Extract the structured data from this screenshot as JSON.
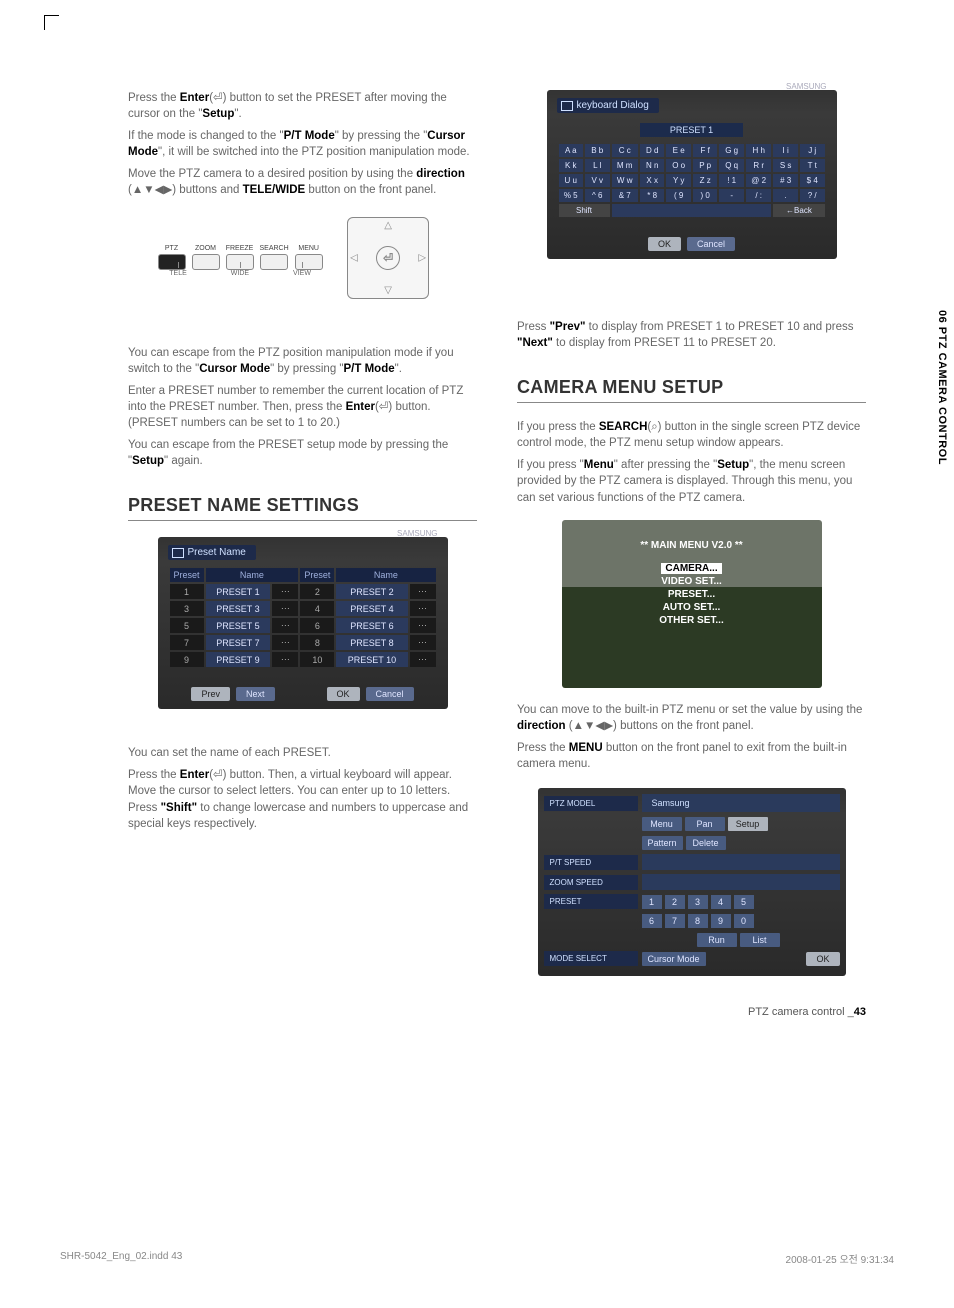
{
  "side_tab": "06 PTZ CAMERA CONTROL",
  "left": {
    "p1a": "Press the ",
    "p1b": "Enter",
    "p1c": "(⏎) button to set the PRESET after moving the cursor on the \"",
    "p1d": "Setup",
    "p1e": "\".",
    "p2a": "If the mode is changed to the \"",
    "p2b": "P/T Mode",
    "p2c": "\" by pressing the \"",
    "p2d": "Cursor Mode",
    "p2e": "\", it will be switched into the PTZ position manipulation mode.",
    "p3a": "Move the PTZ camera to a desired position by using the ",
    "p3b": "direction",
    "p3c": " (▲▼◀▶) buttons and ",
    "p3d": "TELE/WIDE",
    "p3e": " button on the front panel.",
    "dvr": {
      "b1": "PTZ",
      "b2": "ZOOM",
      "b3": "FREEZE",
      "b4": "SEARCH",
      "b5": "MENU",
      "tele": "TELE",
      "wide": "WIDE",
      "view": "VIEW"
    },
    "p4a": "You can escape from the PTZ position manipulation mode if you switch to the \"",
    "p4b": "Cursor Mode",
    "p4c": "\" by pressing \"",
    "p4d": "P/T Mode",
    "p4e": "\".",
    "p5": "Enter a PRESET number to remember the current location of PTZ into the PRESET number. Then, press the ",
    "p5b": "Enter",
    "p5c": "(⏎) button. (PRESET numbers can be set to 1 to 20.)",
    "p6a": "You can escape from the PRESET setup mode by pressing the \"",
    "p6b": "Setup",
    "p6c": "\" again.",
    "h_preset_name": "PRESET NAME SETTINGS",
    "table": {
      "title": "Preset Name",
      "brand": "SAMSUNG",
      "hdr_preset": "Preset",
      "hdr_name": "Name",
      "rows": [
        {
          "n1": "1",
          "v1": "PRESET 1",
          "n2": "2",
          "v2": "PRESET 2"
        },
        {
          "n1": "3",
          "v1": "PRESET 3",
          "n2": "4",
          "v2": "PRESET 4"
        },
        {
          "n1": "5",
          "v1": "PRESET 5",
          "n2": "6",
          "v2": "PRESET 6"
        },
        {
          "n1": "7",
          "v1": "PRESET 7",
          "n2": "8",
          "v2": "PRESET 8"
        },
        {
          "n1": "9",
          "v1": "PRESET 9",
          "n2": "10",
          "v2": "PRESET 10"
        }
      ],
      "prev": "Prev",
      "next": "Next",
      "ok": "OK",
      "cancel": "Cancel"
    },
    "p7": "You can set the name of each PRESET.",
    "p8a": "Press the ",
    "p8b": "Enter",
    "p8c": "(⏎) button. Then, a virtual keyboard will appear. Move the cursor to select letters. You can enter up to 10 letters. Press ",
    "p8d": "\"Shift\"",
    "p8e": " to change lowercase and numbers to uppercase and special keys respectively."
  },
  "right": {
    "kb": {
      "title": "keyboard Dialog",
      "brand": "SAMSUNG",
      "preset": "PRESET 1",
      "r1": [
        "A a",
        "B b",
        "C c",
        "D d",
        "E e",
        "F f",
        "G g",
        "H h",
        "I i",
        "J j"
      ],
      "r2": [
        "K k",
        "L l",
        "M m",
        "N n",
        "O o",
        "P p",
        "Q q",
        "R r",
        "S s",
        "T t"
      ],
      "r3": [
        "U u",
        "V v",
        "W w",
        "X x",
        "Y y",
        "Z z",
        "! 1",
        "@ 2",
        "# 3",
        "$ 4"
      ],
      "r4": [
        "% 5",
        "^ 6",
        "& 7",
        "* 8",
        "( 9",
        ") 0",
        "-  ",
        "/ :",
        ". ",
        "? /"
      ],
      "shift": "Shift",
      "back": "←Back",
      "ok": "OK",
      "cancel": "Cancel"
    },
    "p1a": "Press ",
    "p1b": "\"Prev\"",
    "p1c": " to display from PRESET 1 to PRESET 10 and press ",
    "p1d": "\"Next\"",
    "p1e": " to display from PRESET 11 to PRESET 20.",
    "h_cam": "CAMERA MENU SETUP",
    "p2a": "If you press the ",
    "p2b": "SEARCH",
    "p2c": "(⌕) button in the single screen PTZ device control mode, the PTZ menu setup window appears.",
    "p3a": "If you press \"",
    "p3b": "Menu",
    "p3c": "\" after pressing the \"",
    "p3d": "Setup",
    "p3e": "\", the menu screen provided by the PTZ camera is displayed. Through this menu, you can set various functions of the PTZ camera.",
    "cam": {
      "title": "** MAIN MENU V2.0 **",
      "i1": "CAMERA...",
      "i2": "VIDEO SET...",
      "i3": "PRESET...",
      "i4": "AUTO SET...",
      "i5": "OTHER SET..."
    },
    "p4a": "You can move to the built-in PTZ menu or set the value by using the ",
    "p4b": "direction",
    "p4c": " (▲▼◀▶) buttons on the front panel.",
    "p5a": "Press the ",
    "p5b": "MENU",
    "p5c": " button on the front panel to exit from the built-in camera menu.",
    "ctrl": {
      "model_l": "PTZ MODEL",
      "model_v": "Samsung",
      "menu": "Menu",
      "pan": "Pan",
      "setup": "Setup",
      "pattern": "Pattern",
      "delete": "Delete",
      "pt_l": "P/T SPEED",
      "zoom_l": "ZOOM SPEED",
      "preset_l": "PRESET",
      "n": [
        "1",
        "2",
        "3",
        "4",
        "5",
        "6",
        "7",
        "8",
        "9",
        "0"
      ],
      "run": "Run",
      "list": "List",
      "mode_l": "MODE SELECT",
      "mode_v": "Cursor Mode",
      "ok": "OK"
    }
  },
  "footer": {
    "file": "SHR-5042_Eng_02.indd   43",
    "ts": "2008-01-25   오전 9:31:34",
    "pg_a": "PTZ camera control _",
    "pg_b": "43"
  }
}
